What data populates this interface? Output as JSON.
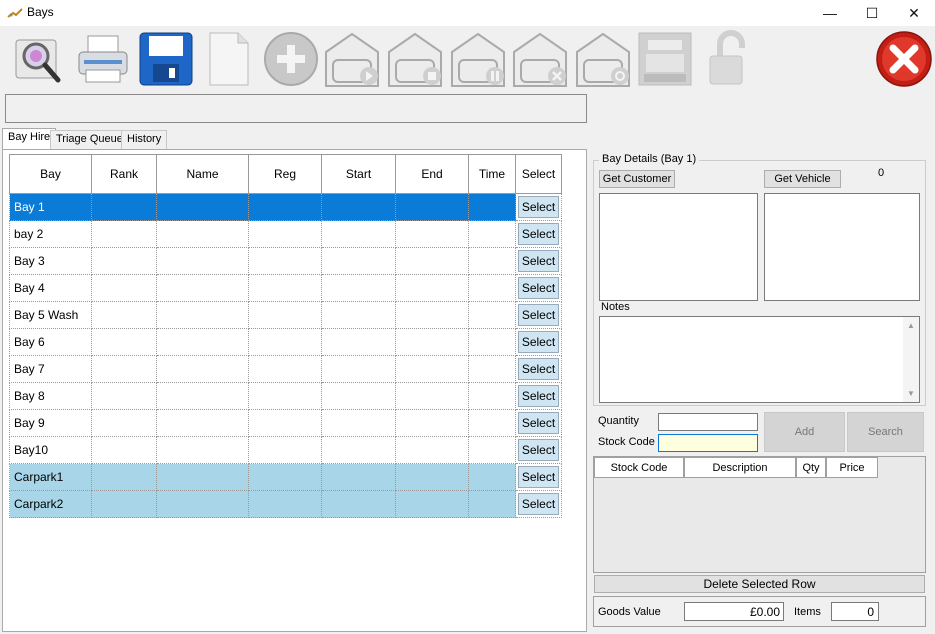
{
  "window": {
    "title": "Bays",
    "minimize": "—",
    "maximize": "☐",
    "close": "✕"
  },
  "toolbar": {
    "items": [
      {
        "name": "search-preview-icon"
      },
      {
        "name": "print-icon"
      },
      {
        "name": "save-icon"
      },
      {
        "name": "new-document-icon"
      },
      {
        "name": "add-icon"
      },
      {
        "name": "garage-start-icon"
      },
      {
        "name": "garage-stop-icon"
      },
      {
        "name": "garage-pause-icon"
      },
      {
        "name": "garage-cancel-icon"
      },
      {
        "name": "garage-refresh-icon"
      },
      {
        "name": "cash-register-icon"
      },
      {
        "name": "unlock-icon"
      },
      {
        "name": "exit-icon"
      }
    ]
  },
  "tabs": [
    {
      "label": "Bay Hire"
    },
    {
      "label": "Triage Queue"
    },
    {
      "label": "History"
    }
  ],
  "grid": {
    "columns": [
      "Bay",
      "Rank",
      "Name",
      "Reg",
      "Start",
      "End",
      "Time",
      "Select"
    ],
    "select_label": "Select",
    "rows": [
      {
        "bay": "Bay 1",
        "state": "selected"
      },
      {
        "bay": "bay 2",
        "state": "normal"
      },
      {
        "bay": "Bay 3",
        "state": "normal"
      },
      {
        "bay": "Bay 4",
        "state": "normal"
      },
      {
        "bay": "Bay 5 Wash",
        "state": "normal"
      },
      {
        "bay": "Bay 6",
        "state": "normal"
      },
      {
        "bay": "Bay 7",
        "state": "normal"
      },
      {
        "bay": "Bay 8",
        "state": "normal"
      },
      {
        "bay": "Bay 9",
        "state": "normal"
      },
      {
        "bay": "Bay10",
        "state": "normal"
      },
      {
        "bay": "Carpark1",
        "state": "highlight"
      },
      {
        "bay": "Carpark2",
        "state": "highlight"
      }
    ]
  },
  "details": {
    "group_title": "Bay Details (Bay 1)",
    "get_customer": "Get Customer",
    "get_vehicle": "Get Vehicle",
    "vehicle_count": "0",
    "notes_label": "Notes"
  },
  "stock": {
    "quantity_label": "Quantity",
    "stock_code_label": "Stock Code",
    "quantity_value": "",
    "stock_code_value": "",
    "add_label": "Add",
    "search_label": "Search",
    "columns": [
      "Stock Code",
      "Description",
      "Qty",
      "Price"
    ],
    "delete_label": "Delete Selected Row",
    "goods_value_label": "Goods Value",
    "goods_value": "£0.00",
    "items_label": "Items",
    "items_value": "0"
  }
}
